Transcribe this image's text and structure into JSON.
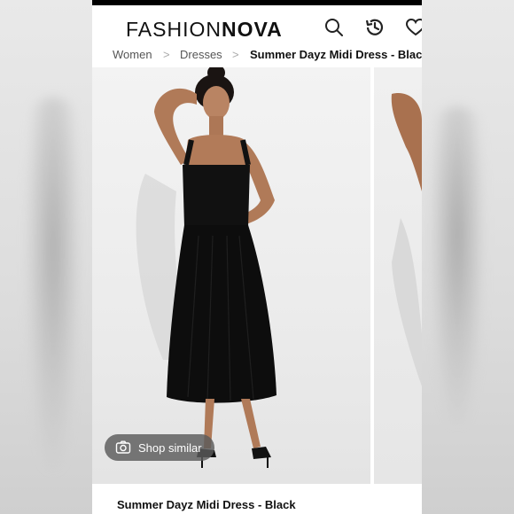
{
  "header": {
    "logo_part1": "FASHION",
    "logo_part2": "NOVA"
  },
  "icons": [
    "search-icon",
    "history-icon",
    "heart-icon",
    "camera-icon",
    "chevron-right-icon"
  ],
  "breadcrumb": {
    "items": [
      "Women",
      "Dresses",
      "Summer Dayz Midi Dress - Black"
    ],
    "separator": ">"
  },
  "gallery": {
    "shop_similar_label": "Shop similar"
  },
  "product": {
    "title": "Summer Dayz Midi Dress - Black"
  }
}
